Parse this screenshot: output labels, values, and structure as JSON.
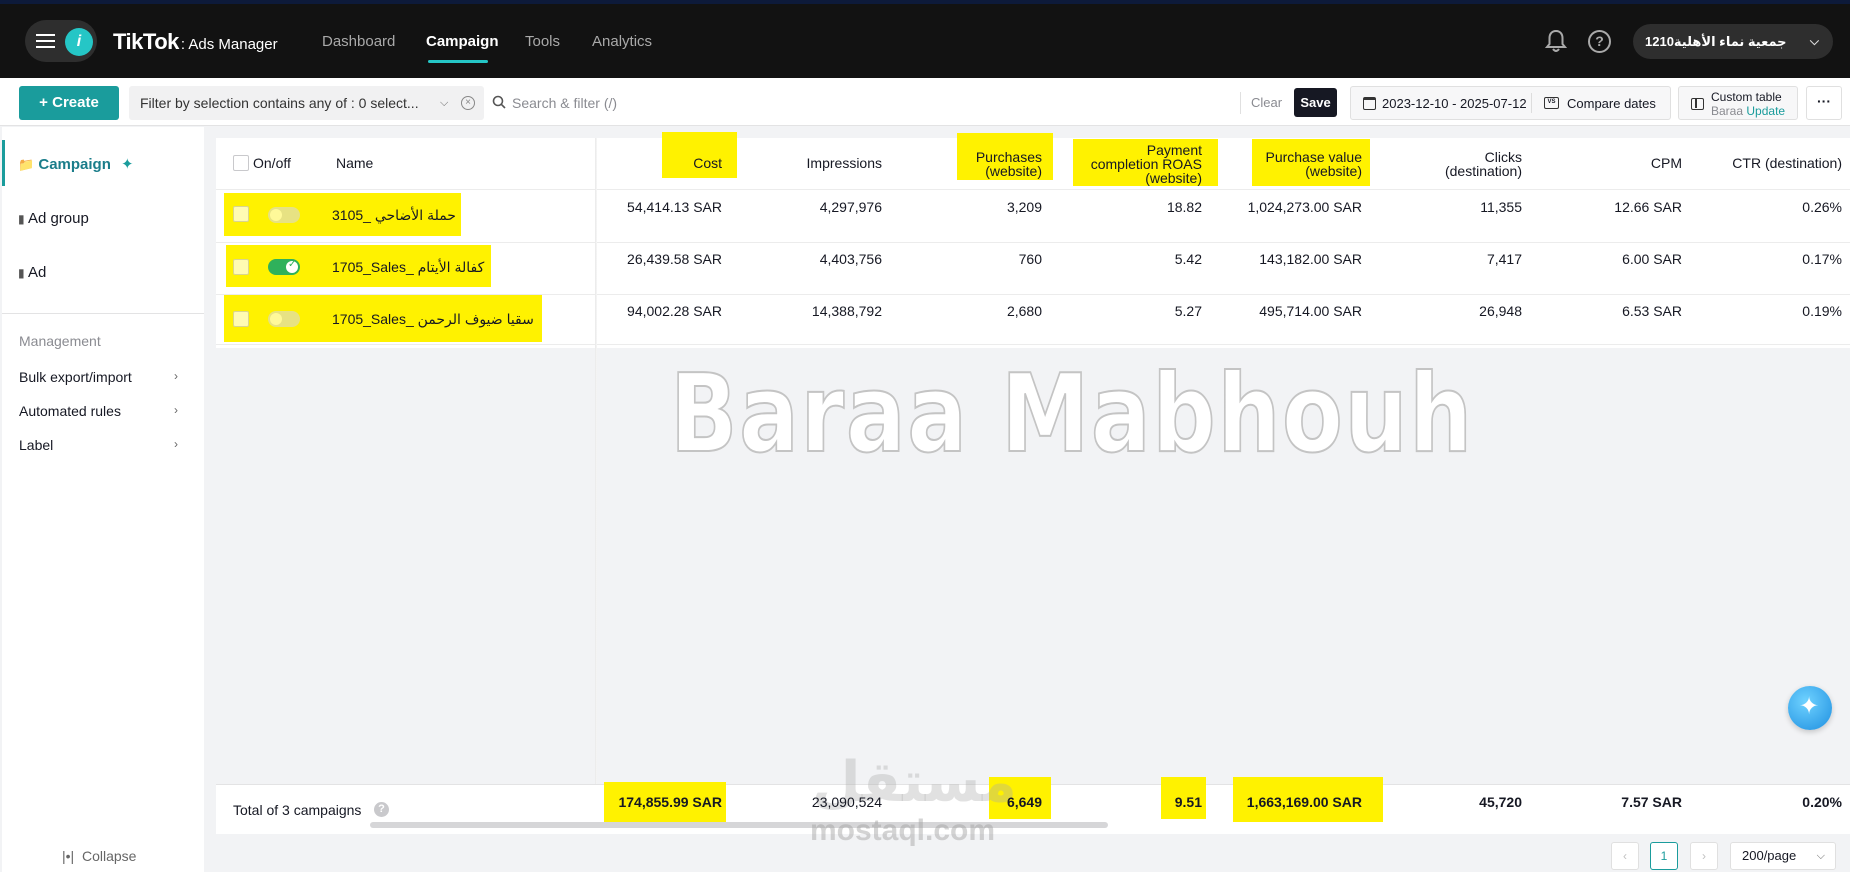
{
  "header": {
    "brand": "TikTok",
    "product": ": Ads Manager",
    "info_badge": "i",
    "nav": [
      {
        "label": "Dashboard"
      },
      {
        "label": "Campaign"
      },
      {
        "label": "Tools"
      },
      {
        "label": "Analytics"
      }
    ],
    "help_glyph": "?",
    "account_name": "جمعية نماء الأهلية1210"
  },
  "toolbar": {
    "create_label": "Create",
    "filter_text": "Filter by selection contains any of : 0 select...",
    "search_placeholder": "Search & filter (/)",
    "clear_label": "Clear",
    "save_label": "Save",
    "date_range": "2023-12-10 - 2025-07-12",
    "compare_label": "Compare dates",
    "vs_glyph": "VS",
    "custom_table_label": "Custom table",
    "custom_table_owner": "Baraa",
    "custom_table_update": "Update",
    "more_glyph": "···"
  },
  "sidebar": {
    "levels": [
      {
        "label": "Campaign"
      },
      {
        "label": "Ad group"
      },
      {
        "label": "Ad"
      }
    ],
    "management_heading": "Management",
    "management_items": [
      {
        "label": "Bulk export/import"
      },
      {
        "label": "Automated rules"
      },
      {
        "label": "Label"
      }
    ],
    "collapse_label": "Collapse"
  },
  "table": {
    "columns": {
      "onoff": "On/off",
      "name": "Name",
      "cost": "Cost",
      "impressions": "Impressions",
      "purchases": [
        "Purchases",
        "(website)"
      ],
      "roas": [
        "Payment",
        "completion ROAS",
        "(website)"
      ],
      "purchase_value": [
        "Purchase value",
        "(website)"
      ],
      "clicks": [
        "Clicks",
        "(destination)"
      ],
      "cpm": "CPM",
      "ctr": "CTR (destination)"
    },
    "rows": [
      {
        "status": false,
        "name": "3105_ حملة الأضاحي",
        "cost": "54,414.13 SAR",
        "impressions": "4,297,976",
        "purchases": "3,209",
        "roas": "18.82",
        "purchase_value": "1,024,273.00 SAR",
        "clicks": "11,355",
        "cpm": "12.66 SAR",
        "ctr": "0.26%"
      },
      {
        "status": true,
        "name": "1705_Sales_ كفالة الأيتام",
        "cost": "26,439.58 SAR",
        "impressions": "4,403,756",
        "purchases": "760",
        "roas": "5.42",
        "purchase_value": "143,182.00 SAR",
        "clicks": "7,417",
        "cpm": "6.00 SAR",
        "ctr": "0.17%"
      },
      {
        "status": false,
        "name": "1705_Sales_ سقيا ضيوف الرحمن",
        "cost": "94,002.28 SAR",
        "impressions": "14,388,792",
        "purchases": "2,680",
        "roas": "5.27",
        "purchase_value": "495,714.00 SAR",
        "clicks": "26,948",
        "cpm": "6.53 SAR",
        "ctr": "0.19%"
      }
    ],
    "total": {
      "label": "Total of 3 campaigns",
      "cost": "174,855.99 SAR",
      "impressions": "23,090,524",
      "purchases": "6,649",
      "roas": "9.51",
      "purchase_value": "1,663,169.00 SAR",
      "clicks": "45,720",
      "cpm": "7.57 SAR",
      "ctr": "0.20%"
    }
  },
  "pagination": {
    "prev": "‹",
    "current_page": "1",
    "next": "›",
    "per_page": "200/page"
  },
  "watermarks": {
    "main": "Baraa Mabhouh",
    "mostaql_ar": "مستقل",
    "mostaql_en": "mostaql.com"
  },
  "colors": {
    "accent": "#1a9c9c",
    "highlight": "#fff200",
    "topbar": "#121212",
    "toggle_on": "#2fb15b"
  }
}
